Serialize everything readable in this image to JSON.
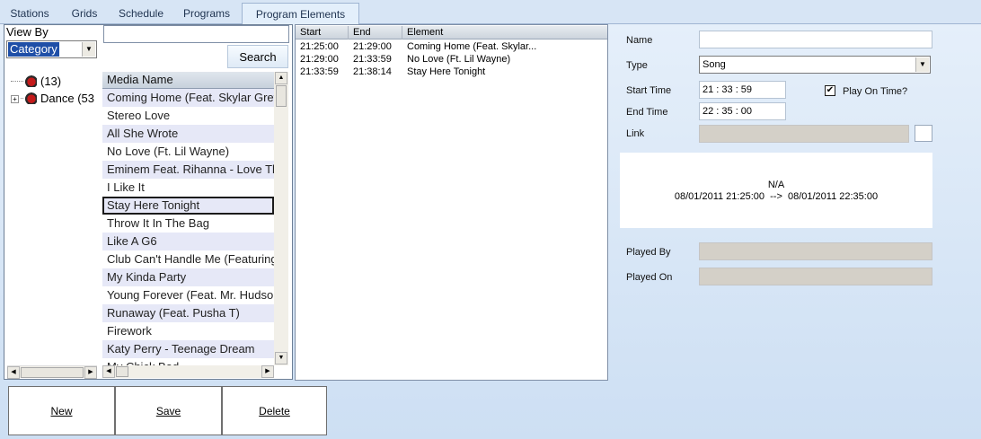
{
  "tabs": [
    {
      "label": "Stations"
    },
    {
      "label": "Grids"
    },
    {
      "label": "Schedule"
    },
    {
      "label": "Programs"
    },
    {
      "label": "Program Elements",
      "active": true
    }
  ],
  "left": {
    "view_by_label": "View By",
    "category_value": "Category",
    "search_value": "",
    "search_button": "Search",
    "tree": [
      {
        "label": "(13)",
        "expandable": false
      },
      {
        "label": "Dance (53",
        "expandable": true
      }
    ],
    "media_header": "Media Name",
    "media": [
      "Coming Home (Feat. Skylar Grey)",
      "Stereo Love",
      "All She Wrote",
      "No Love (Ft. Lil Wayne)",
      "Eminem Feat. Rihanna - Love The Way You Lie",
      "I Like It",
      "Stay Here Tonight",
      "Throw It In The Bag",
      "Like A G6",
      "Club Can't Handle Me (Featuring David Guetta)",
      "My Kinda Party",
      "Young Forever (Feat. Mr. Hudson)",
      "Runaway (Feat. Pusha T)",
      "Firework",
      "Katy Perry - Teenage Dream",
      "My Chick Bad"
    ],
    "selected_index": 6
  },
  "grid": {
    "headers": {
      "start": "Start",
      "end": "End",
      "element": "Element"
    },
    "rows": [
      {
        "start": "21:25:00",
        "end": "21:29:00",
        "element": "Coming Home (Feat. Skylar..."
      },
      {
        "start": "21:29:00",
        "end": "21:33:59",
        "element": "No Love (Ft. Lil Wayne)"
      },
      {
        "start": "21:33:59",
        "end": "21:38:14",
        "element": "Stay Here Tonight"
      }
    ]
  },
  "form": {
    "name_label": "Name",
    "name_value": "",
    "type_label": "Type",
    "type_value": "Song",
    "start_label": "Start Time",
    "start_value": "21 : 33 : 59",
    "end_label": "End Time",
    "end_value": "22 : 35 : 00",
    "play_on_time_label": "Play On Time?",
    "play_on_time_checked": "✔",
    "link_label": "Link",
    "link_value": "",
    "info_line1": "N/A",
    "info_line2": "08/01/2011 21:25:00  -->  08/01/2011 22:35:00",
    "played_by_label": "Played By",
    "played_by_value": "",
    "played_on_label": "Played On",
    "played_on_value": ""
  },
  "buttons": {
    "new": "New",
    "save": "Save",
    "delete": "Delete"
  },
  "icons": {
    "expand": "plus-box-icon",
    "category": "record-disc-icon",
    "dropdown": "chevron-down-icon"
  }
}
